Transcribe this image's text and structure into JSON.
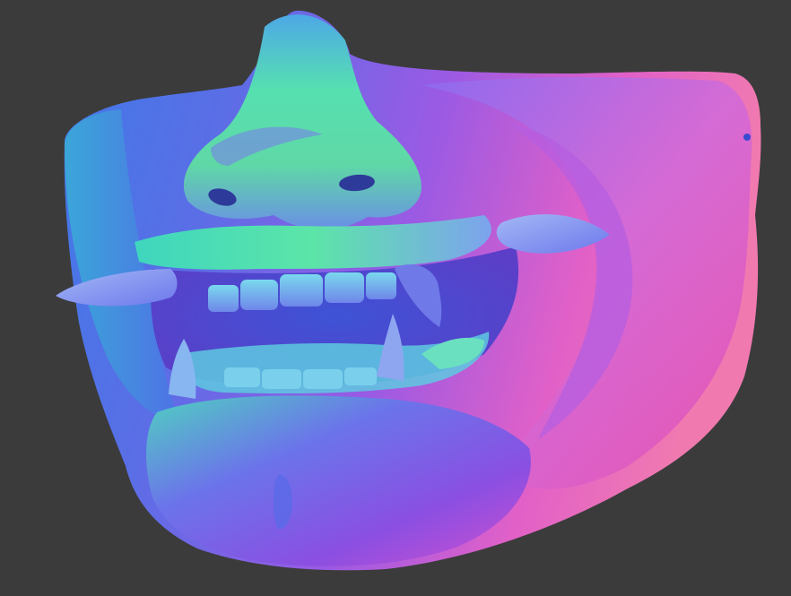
{
  "viewport": {
    "background": "#3b3b3b",
    "subject": "oni-mask-icon",
    "shading": "normal-map",
    "palette": {
      "blue": "#4f6fe8",
      "cyan": "#4ecbd6",
      "green": "#5fe3a0",
      "purple": "#8a55e6",
      "magenta": "#d24fd6",
      "pink": "#f06aa8",
      "violet": "#6b4fe0"
    }
  }
}
